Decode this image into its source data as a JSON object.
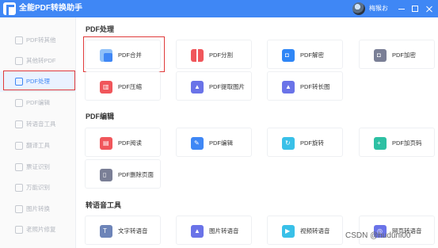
{
  "app": {
    "title": "全能PDF转换助手",
    "user_name": "梅猴お"
  },
  "colors": {
    "brand": "#3f87f5",
    "highlight": "#e03a3a"
  },
  "sidebar": {
    "items": [
      {
        "label": "PDF转其他",
        "icon": "pdf-export-icon"
      },
      {
        "label": "其他转PDF",
        "icon": "pdf-import-icon"
      },
      {
        "label": "PDF处理",
        "icon": "pdf-process-icon",
        "active": true
      },
      {
        "label": "PDF编辑",
        "icon": "pdf-edit-icon"
      },
      {
        "label": "转语音工具",
        "icon": "voice-tool-icon"
      },
      {
        "label": "翻译工具",
        "icon": "translate-icon"
      },
      {
        "label": "票证识别",
        "icon": "receipt-icon"
      },
      {
        "label": "万能识别",
        "icon": "ocr-icon"
      },
      {
        "label": "图片转换",
        "icon": "image-convert-icon"
      },
      {
        "label": "老照片修复",
        "icon": "photo-restore-icon"
      }
    ]
  },
  "sections": [
    {
      "title": "PDF处理",
      "tools": [
        {
          "label": "PDF合并",
          "icon": "merge-icon",
          "color": "#3f87f5"
        },
        {
          "label": "PDF分割",
          "icon": "split-icon",
          "color": "#f0565b"
        },
        {
          "label": "PDF解密",
          "icon": "unlock-icon",
          "color": "#2f86f6"
        },
        {
          "label": "PDF加密",
          "icon": "lock-icon",
          "color": "#7a7f96"
        },
        {
          "label": "PDF压缩",
          "icon": "compress-icon",
          "color": "#f0565b"
        },
        {
          "label": "PDF提取图片",
          "icon": "extract-image-icon",
          "color": "#6a73e8"
        },
        {
          "label": "PDF转长图",
          "icon": "long-image-icon",
          "color": "#6a73e8"
        }
      ]
    },
    {
      "title": "PDF编辑",
      "tools": [
        {
          "label": "PDF阅读",
          "icon": "read-icon",
          "color": "#f0565b"
        },
        {
          "label": "PDF编辑",
          "icon": "edit-icon",
          "color": "#3f87f5"
        },
        {
          "label": "PDF旋转",
          "icon": "rotate-icon",
          "color": "#39c0e8"
        },
        {
          "label": "PDF加页码",
          "icon": "page-number-icon",
          "color": "#2dc0a3"
        },
        {
          "label": "PDF删除页面",
          "icon": "delete-page-icon",
          "color": "#7a7f96"
        }
      ]
    },
    {
      "title": "转语音工具",
      "tools": [
        {
          "label": "文字转语音",
          "icon": "text-to-speech-icon",
          "color": "#6d84b8"
        },
        {
          "label": "图片转语音",
          "icon": "image-to-speech-icon",
          "color": "#6a73e8"
        },
        {
          "label": "视频转语音",
          "icon": "video-to-speech-icon",
          "color": "#39c0e8"
        },
        {
          "label": "网页转语音",
          "icon": "web-to-speech-icon",
          "color": "#6a73e8"
        }
      ]
    }
  ],
  "watermark": "CSDN @huduni00"
}
